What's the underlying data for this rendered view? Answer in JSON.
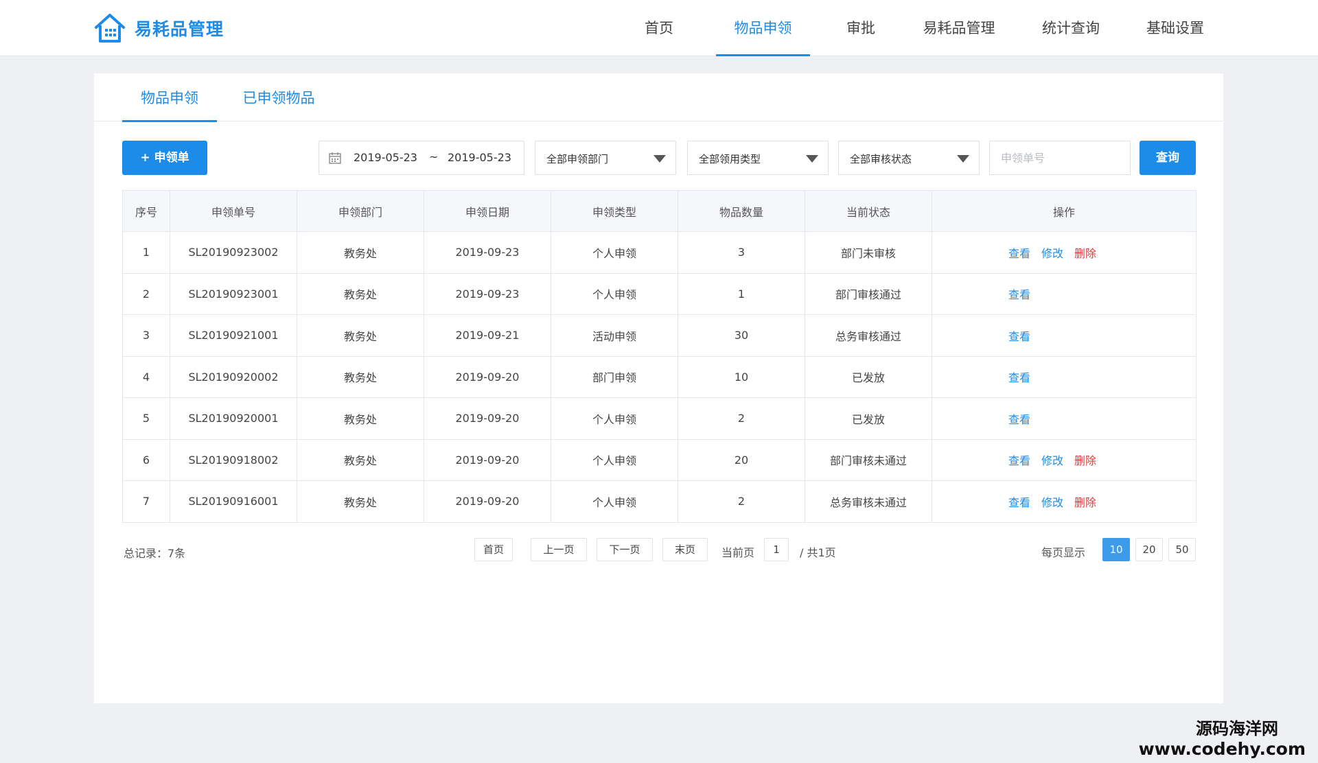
{
  "app": {
    "title": "易耗品管理",
    "accent": "#1d8be8"
  },
  "nav": [
    {
      "label": "首页"
    },
    {
      "label": "物品申领"
    },
    {
      "label": "审批"
    },
    {
      "label": "易耗品管理"
    },
    {
      "label": "统计查询"
    },
    {
      "label": "基础设置"
    }
  ],
  "tabs": [
    {
      "label": "物品申领"
    },
    {
      "label": "已申领物品"
    }
  ],
  "toolbar": {
    "add_label": "+ 申领单",
    "date_start": "2019-05-23",
    "date_sep": "~",
    "date_end": "2019-05-23",
    "dept_select": "全部申领部门",
    "type_select": "全部领用类型",
    "status_select": "全部审核状态",
    "order_placeholder": "申领单号",
    "search_label": "查询"
  },
  "table": {
    "headers": [
      "序号",
      "申领单号",
      "申领部门",
      "申领日期",
      "申领类型",
      "物品数量",
      "当前状态",
      "操作"
    ],
    "action_labels": {
      "view": "查看",
      "edit": "修改",
      "delete": "删除"
    },
    "rows": [
      {
        "no": "1",
        "order": "SL20190923002",
        "dept": "教务处",
        "date": "2019-09-23",
        "type": "个人申领",
        "qty": "3",
        "status": "部门未审核",
        "actions": [
          "view",
          "edit",
          "delete"
        ]
      },
      {
        "no": "2",
        "order": "SL20190923001",
        "dept": "教务处",
        "date": "2019-09-23",
        "type": "个人申领",
        "qty": "1",
        "status": "部门审核通过",
        "actions": [
          "view"
        ]
      },
      {
        "no": "3",
        "order": "SL20190921001",
        "dept": "教务处",
        "date": "2019-09-21",
        "type": "活动申领",
        "qty": "30",
        "status": "总务审核通过",
        "actions": [
          "view"
        ]
      },
      {
        "no": "4",
        "order": "SL20190920002",
        "dept": "教务处",
        "date": "2019-09-20",
        "type": "部门申领",
        "qty": "10",
        "status": "已发放",
        "actions": [
          "view"
        ]
      },
      {
        "no": "5",
        "order": "SL20190920001",
        "dept": "教务处",
        "date": "2019-09-20",
        "type": "个人申领",
        "qty": "2",
        "status": "已发放",
        "actions": [
          "view"
        ]
      },
      {
        "no": "6",
        "order": "SL20190918002",
        "dept": "教务处",
        "date": "2019-09-20",
        "type": "个人申领",
        "qty": "20",
        "status": "部门审核未通过",
        "actions": [
          "view",
          "edit",
          "delete"
        ]
      },
      {
        "no": "7",
        "order": "SL20190916001",
        "dept": "教务处",
        "date": "2019-09-20",
        "type": "个人申领",
        "qty": "2",
        "status": "总务审核未通过",
        "actions": [
          "view",
          "edit",
          "delete"
        ]
      }
    ]
  },
  "pagination": {
    "total": "总记录：7条",
    "first": "首页",
    "prev": "上一页",
    "next": "下一页",
    "last": "末页",
    "current_label": "当前页",
    "current_value": "1",
    "total_pages": "/  共1页",
    "per_page_label": "每页显示",
    "sizes": [
      "10",
      "20",
      "50"
    ],
    "active_size": "10"
  },
  "watermark": {
    "line1": "源码海洋网",
    "line2": "www.codehy.com"
  }
}
